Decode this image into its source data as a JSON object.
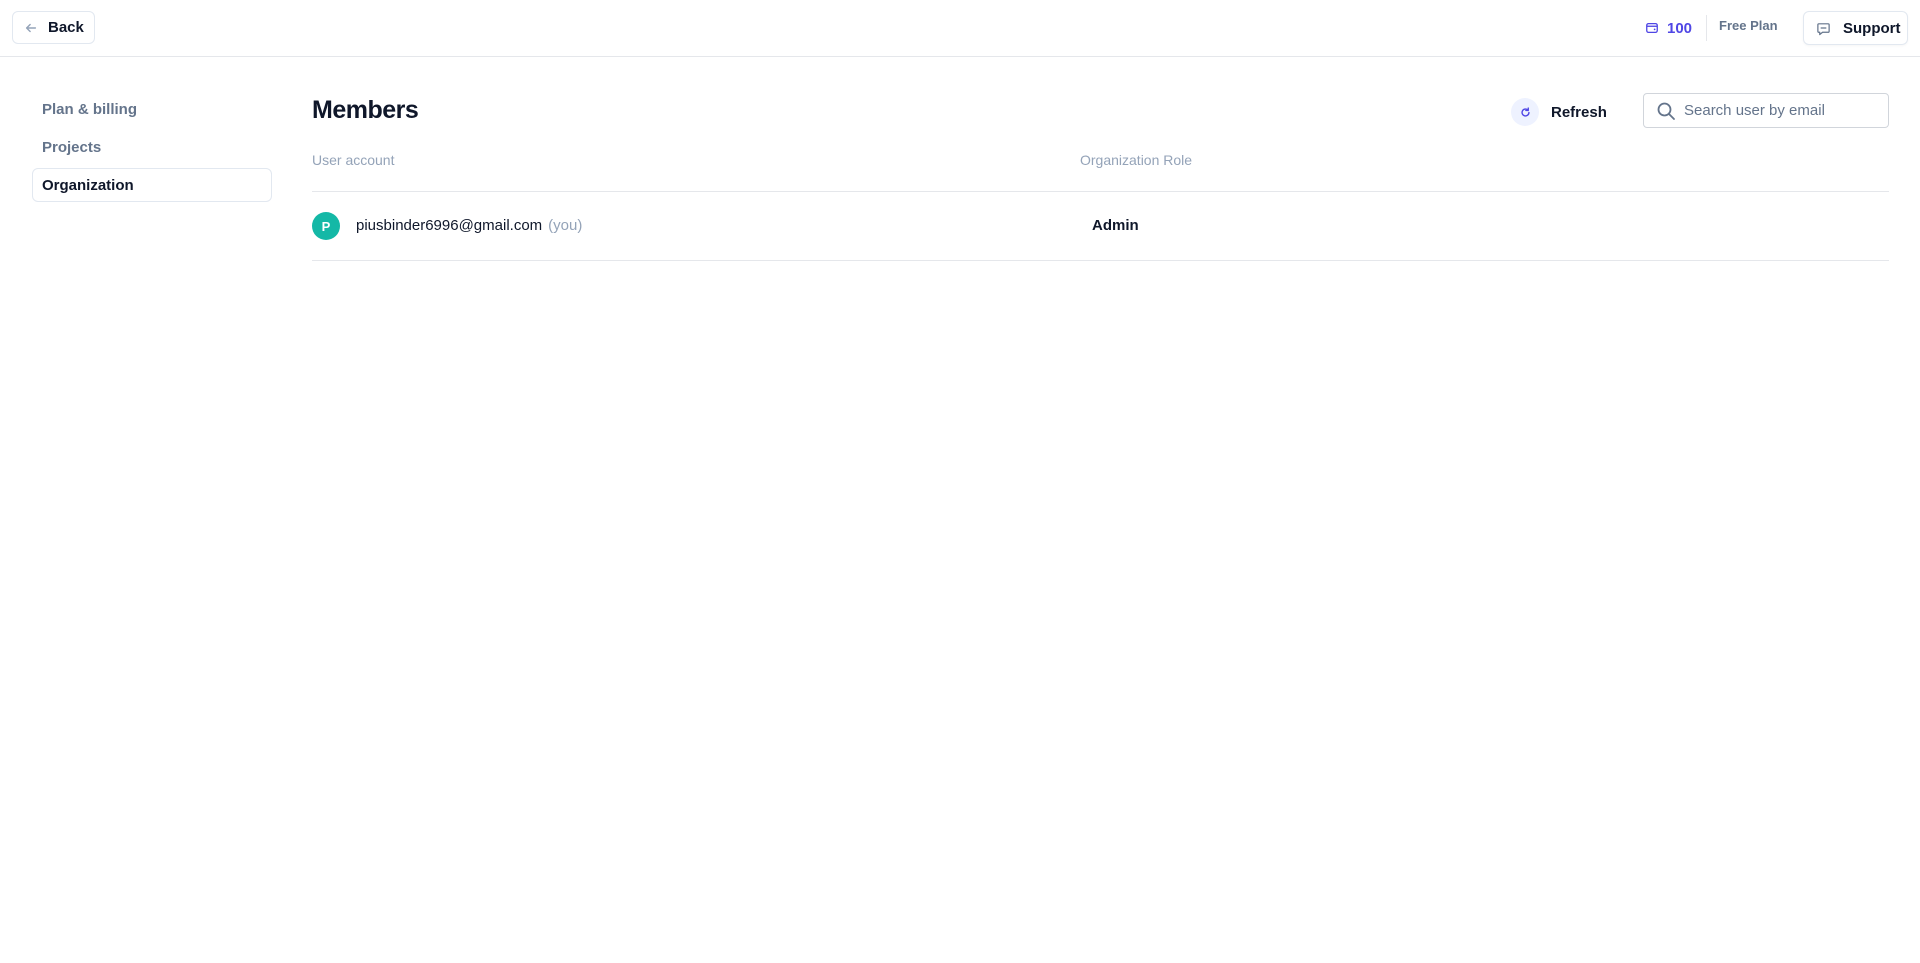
{
  "topbar": {
    "back_label": "Back",
    "credits": "100",
    "plan": "Free Plan",
    "support_label": "Support",
    "back_icon": "arrow-left-icon",
    "credits_icon": "wallet-icon",
    "support_icon": "chat-bubble-icon"
  },
  "sidebar": {
    "items": [
      {
        "label": "Plan & billing",
        "active": false
      },
      {
        "label": "Projects",
        "active": false
      },
      {
        "label": "Organization",
        "active": true
      }
    ]
  },
  "main": {
    "title": "Members",
    "refresh_label": "Refresh",
    "search_placeholder": "Search user by email",
    "columns": [
      "User account",
      "Organization Role"
    ],
    "rows": [
      {
        "avatar": "P",
        "email": "piusbinder6996@gmail.com",
        "you": "(you)",
        "role": "Admin"
      }
    ]
  },
  "colors": {
    "accent": "#4f46e5",
    "avatar": "#14b8a6",
    "muted_text": "#64748b",
    "border": "#e5e7eb"
  }
}
